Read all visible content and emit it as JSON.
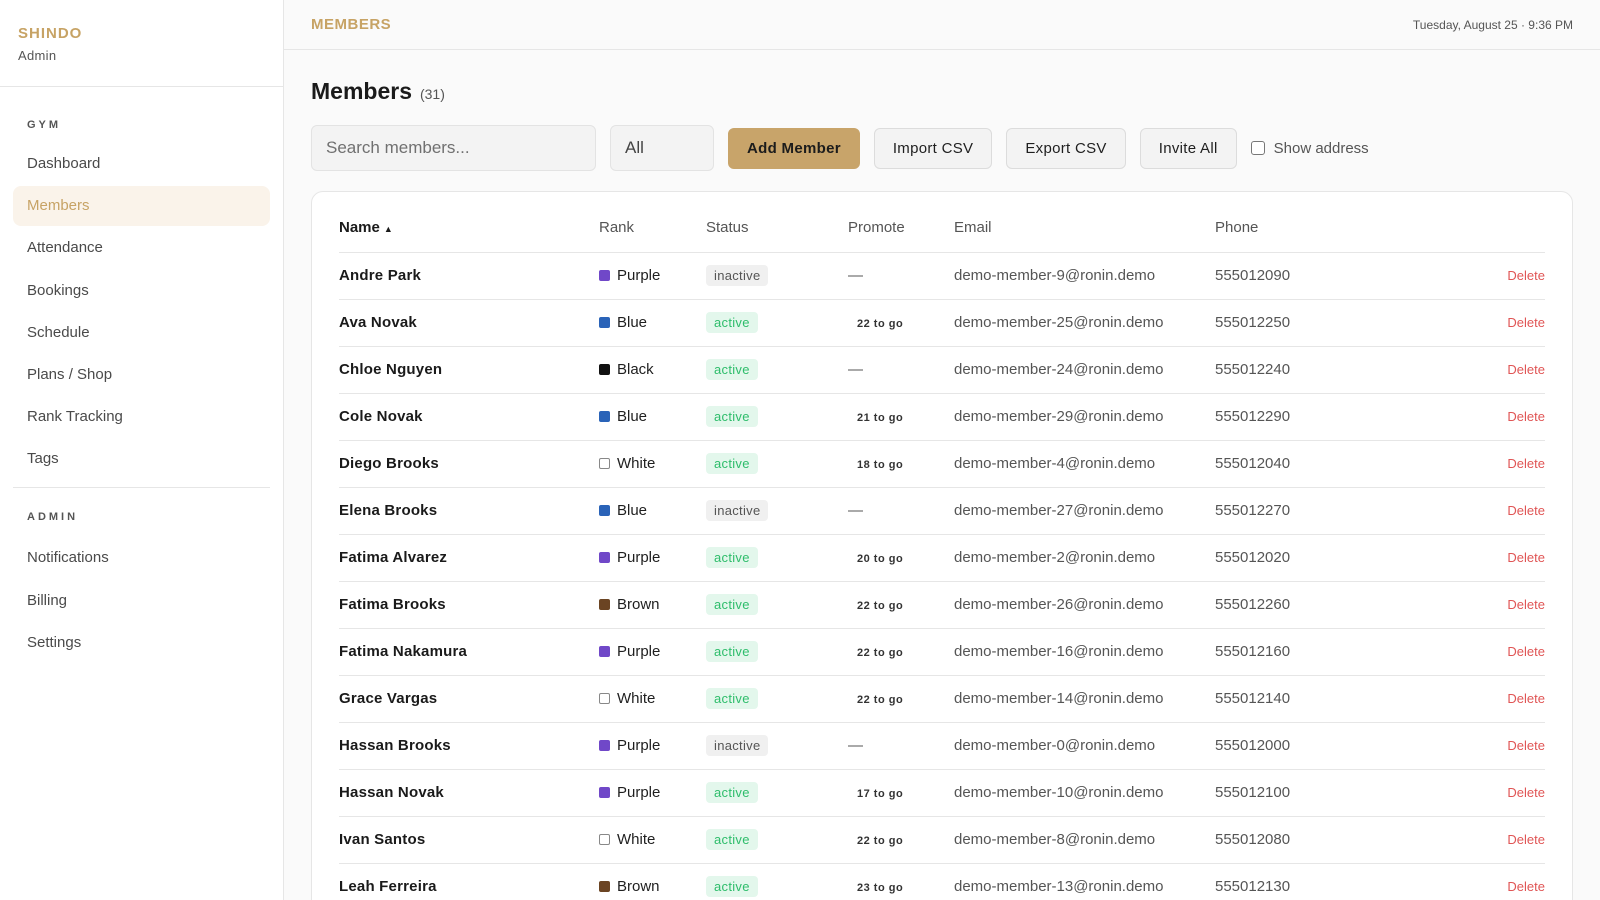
{
  "brand": {
    "name": "SHINDO",
    "role": "Admin"
  },
  "sidebar": {
    "gym_label": "GYM",
    "gym_items": [
      {
        "label": "Dashboard",
        "active": false
      },
      {
        "label": "Members",
        "active": true
      },
      {
        "label": "Attendance",
        "active": false
      },
      {
        "label": "Bookings",
        "active": false
      },
      {
        "label": "Schedule",
        "active": false
      },
      {
        "label": "Plans / Shop",
        "active": false
      },
      {
        "label": "Rank Tracking",
        "active": false
      },
      {
        "label": "Tags",
        "active": false
      }
    ],
    "admin_label": "ADMIN",
    "admin_items": [
      {
        "label": "Notifications"
      },
      {
        "label": "Billing"
      },
      {
        "label": "Settings"
      }
    ]
  },
  "topbar": {
    "title": "MEMBERS",
    "datetime": "Tuesday, August 25 · 9:36 PM"
  },
  "page": {
    "title": "Members",
    "count": "(31)"
  },
  "toolbar": {
    "search_placeholder": "Search members...",
    "filter_value": "All",
    "add_label": "Add Member",
    "import_label": "Import CSV",
    "export_label": "Export CSV",
    "invite_label": "Invite All",
    "show_address_label": "Show address",
    "show_address_checked": false
  },
  "colors": {
    "accent": "#c7a365",
    "active_badge": "#2ebd6b",
    "delete": "#e05555",
    "rank_purple": "#7048c8",
    "rank_blue": "#2a63b8",
    "rank_black": "#111111",
    "rank_brown": "#6b4423",
    "rank_white": "#ffffff"
  },
  "table": {
    "columns": [
      "Name",
      "Rank",
      "Status",
      "Promote",
      "Email",
      "Phone",
      ""
    ],
    "sort_indicator": "▲",
    "delete_label": "Delete",
    "rows": [
      {
        "name": "Andre Park",
        "rank": "Purple",
        "rank_color": "#7048c8",
        "status": "inactive",
        "promote": "—",
        "email": "demo-member-9@ronin.demo",
        "phone": "555012090"
      },
      {
        "name": "Ava Novak",
        "rank": "Blue",
        "rank_color": "#2a63b8",
        "status": "active",
        "promote": "22 to go",
        "email": "demo-member-25@ronin.demo",
        "phone": "555012250"
      },
      {
        "name": "Chloe Nguyen",
        "rank": "Black",
        "rank_color": "#111111",
        "status": "active",
        "promote": "—",
        "email": "demo-member-24@ronin.demo",
        "phone": "555012240"
      },
      {
        "name": "Cole Novak",
        "rank": "Blue",
        "rank_color": "#2a63b8",
        "status": "active",
        "promote": "21 to go",
        "email": "demo-member-29@ronin.demo",
        "phone": "555012290"
      },
      {
        "name": "Diego Brooks",
        "rank": "White",
        "rank_color": "#ffffff",
        "status": "active",
        "promote": "18 to go",
        "email": "demo-member-4@ronin.demo",
        "phone": "555012040"
      },
      {
        "name": "Elena Brooks",
        "rank": "Blue",
        "rank_color": "#2a63b8",
        "status": "inactive",
        "promote": "—",
        "email": "demo-member-27@ronin.demo",
        "phone": "555012270"
      },
      {
        "name": "Fatima Alvarez",
        "rank": "Purple",
        "rank_color": "#7048c8",
        "status": "active",
        "promote": "20 to go",
        "email": "demo-member-2@ronin.demo",
        "phone": "555012020"
      },
      {
        "name": "Fatima Brooks",
        "rank": "Brown",
        "rank_color": "#6b4423",
        "status": "active",
        "promote": "22 to go",
        "email": "demo-member-26@ronin.demo",
        "phone": "555012260"
      },
      {
        "name": "Fatima Nakamura",
        "rank": "Purple",
        "rank_color": "#7048c8",
        "status": "active",
        "promote": "22 to go",
        "email": "demo-member-16@ronin.demo",
        "phone": "555012160"
      },
      {
        "name": "Grace Vargas",
        "rank": "White",
        "rank_color": "#ffffff",
        "status": "active",
        "promote": "22 to go",
        "email": "demo-member-14@ronin.demo",
        "phone": "555012140"
      },
      {
        "name": "Hassan Brooks",
        "rank": "Purple",
        "rank_color": "#7048c8",
        "status": "inactive",
        "promote": "—",
        "email": "demo-member-0@ronin.demo",
        "phone": "555012000"
      },
      {
        "name": "Hassan Novak",
        "rank": "Purple",
        "rank_color": "#7048c8",
        "status": "active",
        "promote": "17 to go",
        "email": "demo-member-10@ronin.demo",
        "phone": "555012100"
      },
      {
        "name": "Ivan Santos",
        "rank": "White",
        "rank_color": "#ffffff",
        "status": "active",
        "promote": "22 to go",
        "email": "demo-member-8@ronin.demo",
        "phone": "555012080"
      },
      {
        "name": "Leah Ferreira",
        "rank": "Brown",
        "rank_color": "#6b4423",
        "status": "active",
        "promote": "23 to go",
        "email": "demo-member-13@ronin.demo",
        "phone": "555012130"
      }
    ]
  }
}
